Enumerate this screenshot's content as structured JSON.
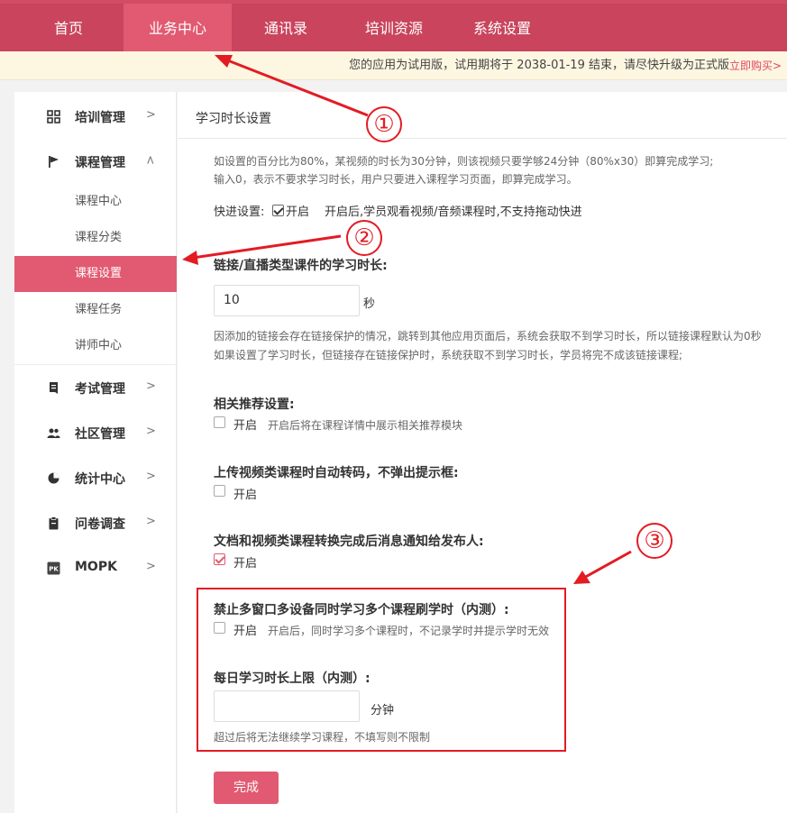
{
  "topnav": {
    "tabs": [
      {
        "label": "首页"
      },
      {
        "label": "业务中心"
      },
      {
        "label": "通讯录"
      },
      {
        "label": "培训资源"
      },
      {
        "label": "系统设置"
      }
    ]
  },
  "banner": {
    "message": "您的应用为试用版，试用期将于 2038-01-19 结束，请尽快升级为正式版",
    "buy_link": "立即购买>"
  },
  "sidebar": {
    "items": [
      {
        "label": "培训管理",
        "icon": "grid-icon"
      },
      {
        "label": "课程管理",
        "icon": "flag-icon"
      },
      {
        "label": "考试管理",
        "icon": "document-icon"
      },
      {
        "label": "社区管理",
        "icon": "users-icon"
      },
      {
        "label": "统计中心",
        "icon": "pie-chart-icon"
      },
      {
        "label": "问卷调查",
        "icon": "clipboard-icon"
      },
      {
        "label": "MOPK",
        "icon": "pk-icon"
      }
    ],
    "course_sub": [
      "课程中心",
      "课程分类",
      "课程设置",
      "课程任务",
      "讲师中心"
    ]
  },
  "main": {
    "title": "学习时长设置",
    "note_percent": "如设置的百分比为80%，某视频的时长为30分钟，则该视频只要学够24分钟（80%x30）即算完成学习;",
    "note_zero": "输入0，表示不要求学习时长，用户只要进入课程学习页面，即算完成学习。",
    "fastforward": {
      "label": "快进设置:",
      "option": "开启",
      "desc": "开启后,学员观看视频/音频课程时,不支持拖动快进"
    },
    "link_duration": {
      "heading": "链接/直播类型课件的学习时长:",
      "value": "10",
      "unit": "秒",
      "note1": "因添加的链接会存在链接保护的情况，跳转到其他应用页面后，系统会获取不到学习时长，所以链接课程默认为0秒",
      "note2": "如果设置了学习时长，但链接存在链接保护时，系统获取不到学习时长，学员将完不成该链接课程;"
    },
    "recommend": {
      "heading": "相关推荐设置:",
      "option": "开启",
      "desc": "开启后将在课程详情中展示相关推荐模块"
    },
    "auto_transcode": {
      "heading": "上传视频类课程时自动转码，不弹出提示框:",
      "option": "开启"
    },
    "notify": {
      "heading": "文档和视频类课程转换完成后消息通知给发布人:",
      "option": "开启"
    },
    "multi_window": {
      "heading": "禁止多窗口多设备同时学习多个课程刷学时（内测）:",
      "option": "开启",
      "desc": "开启后，同时学习多个课程时，不记录学时并提示学时无效"
    },
    "daily_limit": {
      "heading": "每日学习时长上限（内测）:",
      "value": "",
      "unit": "分钟",
      "note": "超过后将无法继续学习课程，不填写则不限制"
    },
    "submit_label": "完成"
  },
  "annotations": {
    "n1": "①",
    "n2": "②",
    "n3": "③",
    "color": "#e31b23"
  },
  "colors": {
    "nav": "#c9445c",
    "accent": "#e15a71"
  }
}
